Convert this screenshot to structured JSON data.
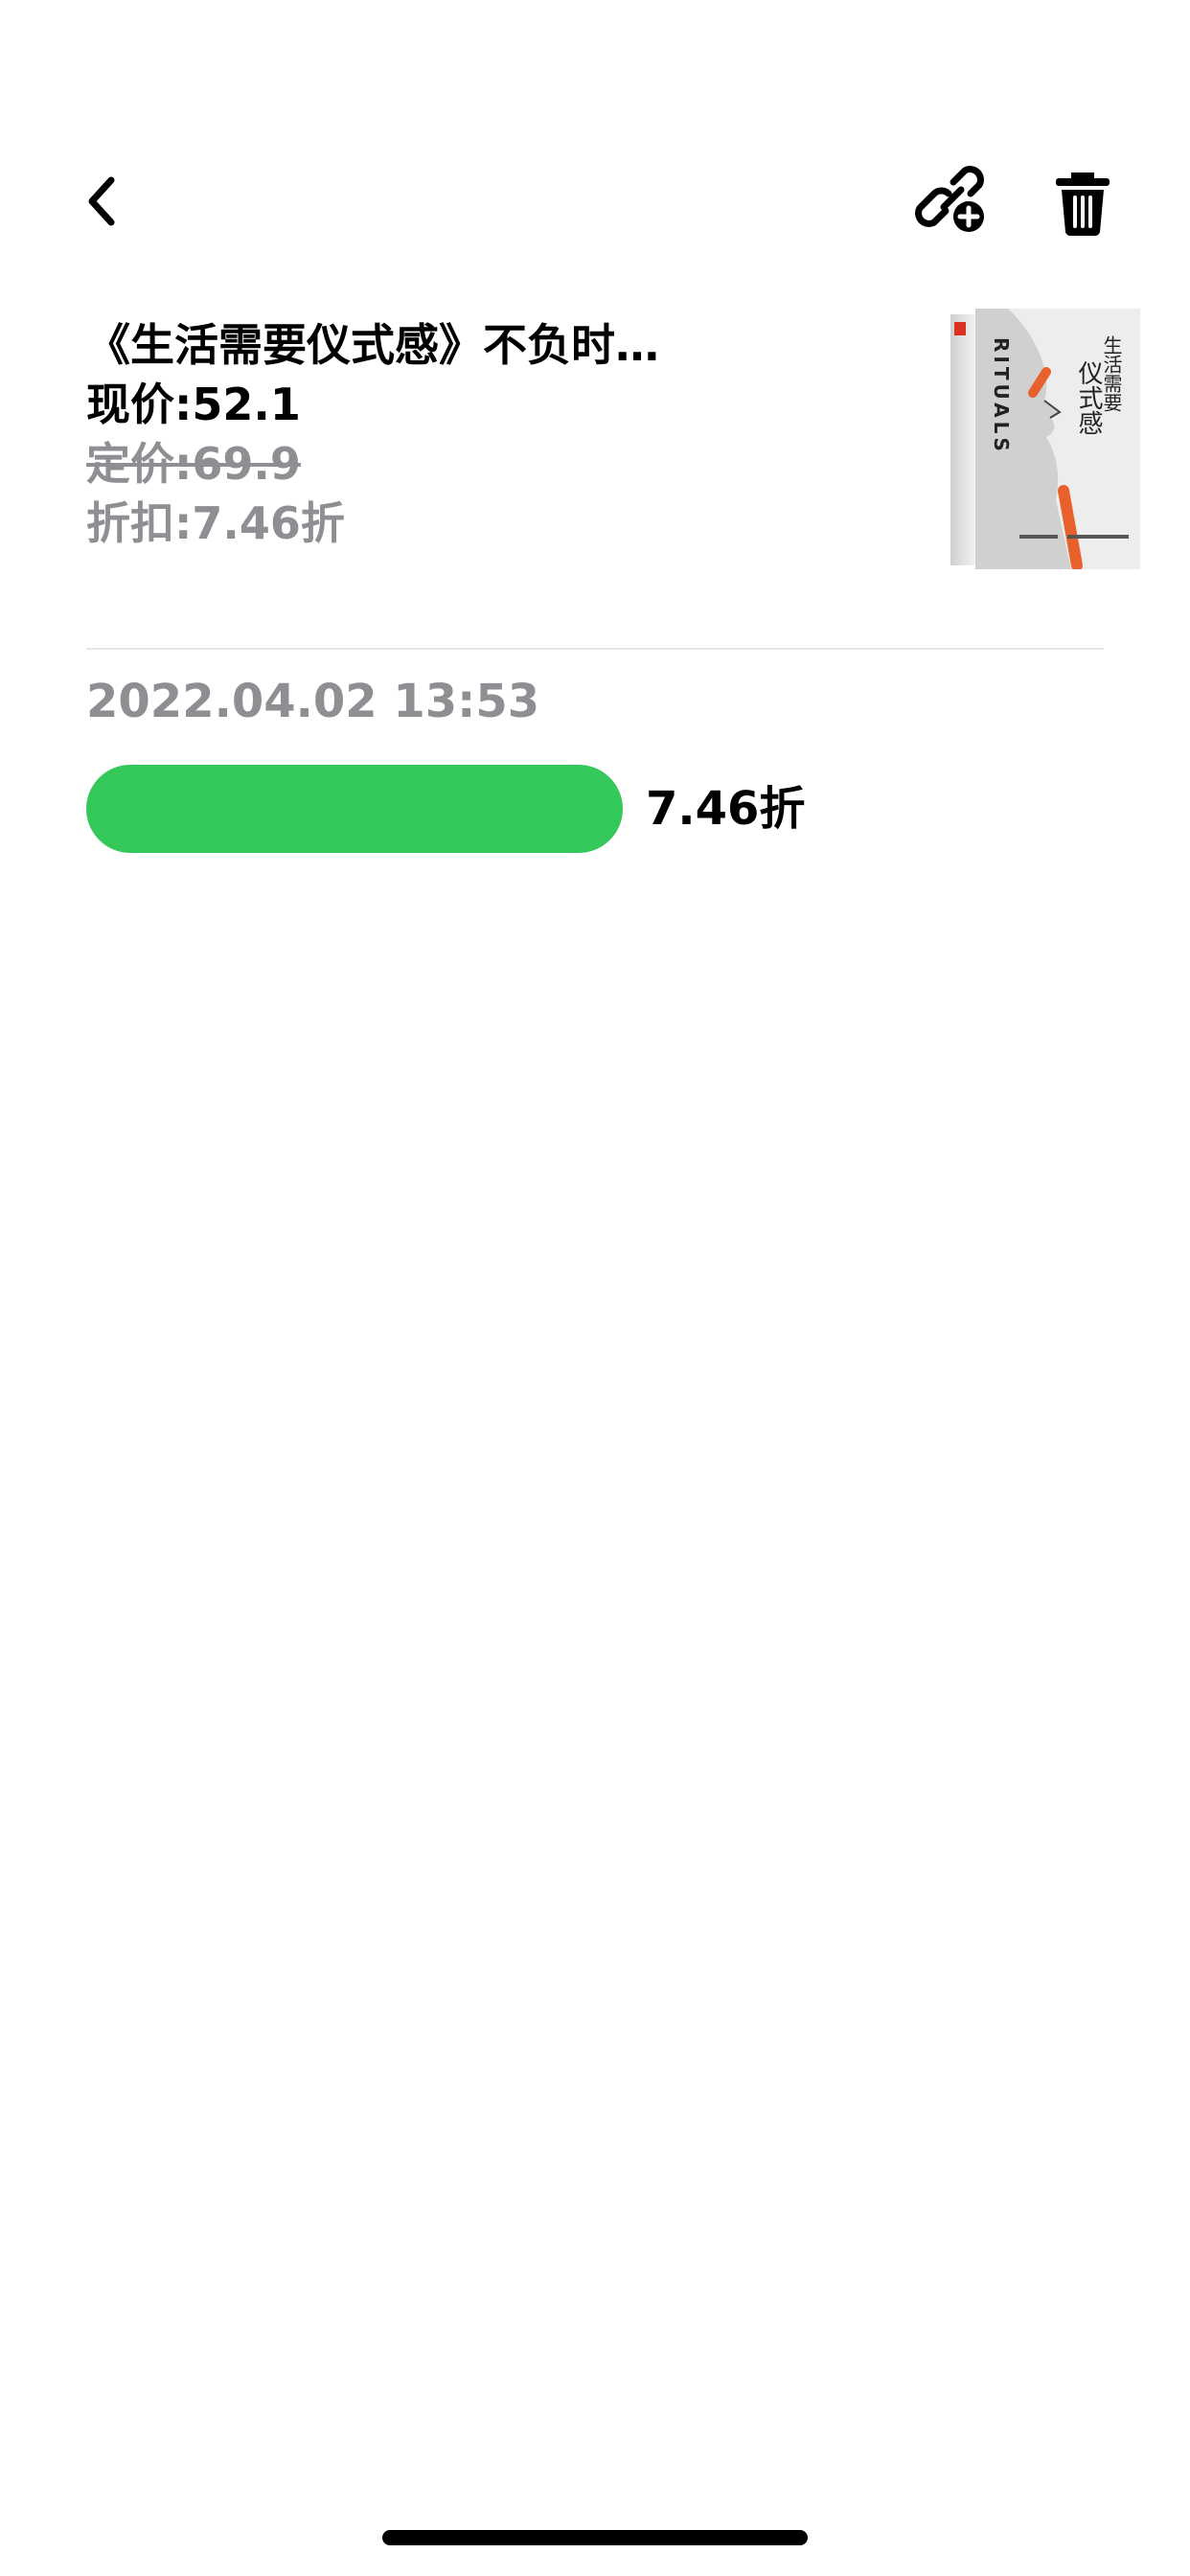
{
  "nav": {
    "back_icon": "chevron-left-icon",
    "link_add_icon": "link-plus-icon",
    "trash_icon": "trash-icon"
  },
  "product": {
    "title": "《生活需要仪式感》不负时…",
    "current_price": "现价:52.1",
    "list_price": "定价:69.9",
    "discount": "折扣:7.46折",
    "cover": {
      "title_vertical": "生活需要仪式感",
      "latin_title": "RITUALS",
      "accent_color": "#e8612c"
    }
  },
  "history": [
    {
      "date": "2022.04.02 13:53",
      "discount_label": "7.46折",
      "bar_fraction": 1.0,
      "bar_color": "#34c759"
    }
  ]
}
